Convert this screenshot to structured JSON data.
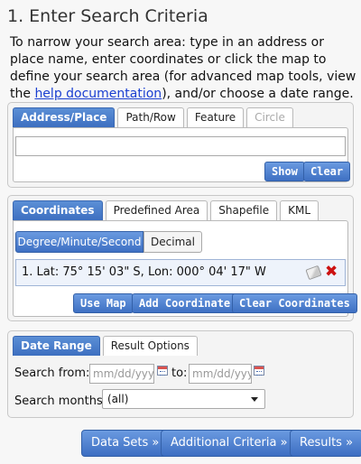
{
  "section_title": "1. Enter Search Criteria",
  "intro": {
    "text_before": "To narrow your search area: type in an address or place name, enter coordinates or click the map to define your search area (for advanced map tools, view the ",
    "link": "help documentation",
    "text_after": "), and/or choose a date range."
  },
  "address_panel": {
    "tabs": [
      "Address/Place",
      "Path/Row",
      "Feature",
      "Circle"
    ],
    "search_value": "",
    "show_label": "Show",
    "clear_label": "Clear"
  },
  "coordinates_panel": {
    "tabs": [
      "Coordinates",
      "Predefined Area",
      "Shapefile",
      "KML"
    ],
    "subtabs": [
      "Degree/Minute/Second",
      "Decimal"
    ],
    "coordinate_entry": "1.  Lat: 75° 15' 03\" S, Lon: 000° 04' 17\" W",
    "use_map_label": "Use Map",
    "add_coordinate_label": "Add Coordinate",
    "clear_coordinates_label": "Clear Coordinates"
  },
  "date_panel": {
    "tabs": [
      "Date Range",
      "Result Options"
    ],
    "search_from_label": "Search from:",
    "from_placeholder": "mm/dd/yyyy",
    "to_label": "to:",
    "to_placeholder": "mm/dd/yyyy",
    "search_months_label": "Search months:",
    "months_selected": "(all)"
  },
  "nav": {
    "data_sets": "Data Sets »",
    "additional_criteria": "Additional Criteria »",
    "results": "Results »"
  },
  "colors": {
    "accent": "#3d6fc0",
    "link": "#1a3fd1",
    "delete": "#cc1111"
  }
}
